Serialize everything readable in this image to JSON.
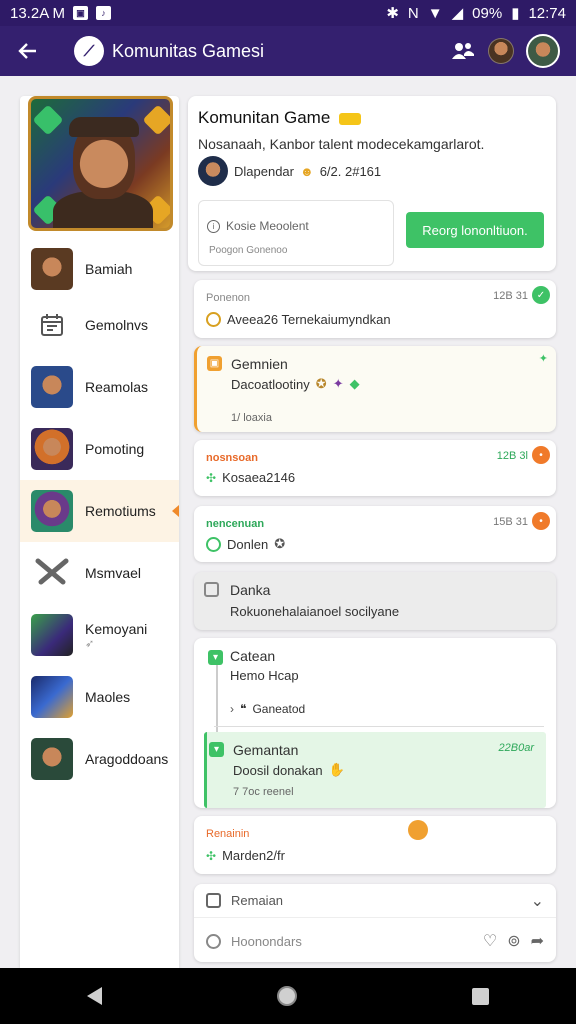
{
  "status": {
    "time_left": "13.2A M",
    "battery": "09%",
    "clock": "12:74"
  },
  "appbar": {
    "title": "Komunitas Gamesi"
  },
  "hero": {},
  "sidebar": {
    "items": [
      {
        "label": "Bamiah"
      },
      {
        "label": "Gemolnvs"
      },
      {
        "label": "Reamolas"
      },
      {
        "label": "Pomoting"
      },
      {
        "label": "Remotiums"
      },
      {
        "label": "Msmvael"
      },
      {
        "label": "Kemoyani"
      },
      {
        "label": "Maoles"
      },
      {
        "label": "Aragoddoans"
      }
    ]
  },
  "group": {
    "title": "Komunitan Game",
    "description": "Nosanaah, Kanbor talent modecekamgarlarot.",
    "user": "Dlapendar",
    "user_meta": "6/2. 2#161",
    "input_placeholder": "Kosie Meoolent",
    "input_sub": "Poogon Gonenoo",
    "join_button": "Reorg lononltiuon."
  },
  "events": [
    {
      "title": "Ponenon",
      "time": "12B 31",
      "text": "Aveea26 Ternekaiumyndkan"
    },
    {
      "title": "Gemnien",
      "text": "Dacoatlootiny",
      "sub": "1/ loaxia"
    },
    {
      "title": "nosnsoan",
      "time": "12B 3l",
      "text": "Kosaea2146"
    },
    {
      "title": "nencenuan",
      "time": "15B 31",
      "text": "Donlen"
    },
    {
      "title": "Danka",
      "text": "Rokuonehalaianoel socilyane"
    },
    {
      "title": "Catean",
      "text": "Hemo Hcap",
      "sub": "Ganeatod"
    },
    {
      "title": "Gemantan",
      "time": "22B0ar",
      "text": "Doosil donakan",
      "sub": "7 7oc reenel"
    },
    {
      "title": "Renainin",
      "text": "Marden2/fr"
    },
    {
      "title": "Remaian"
    }
  ],
  "composer": {
    "placeholder": "Hoonondars"
  }
}
